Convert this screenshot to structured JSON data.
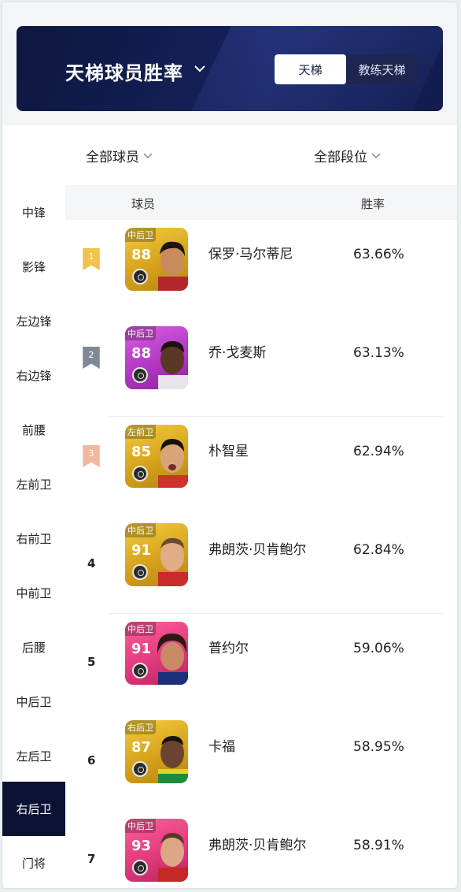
{
  "header": {
    "title": "天梯球员胜率",
    "tabs": [
      {
        "label": "天梯",
        "active": true
      },
      {
        "label": "教练天梯",
        "active": false
      }
    ]
  },
  "filters": {
    "players": "全部球员",
    "divisions": "全部段位"
  },
  "columns": {
    "player": "球员",
    "win_rate": "胜率"
  },
  "sidebar": {
    "items": [
      {
        "label": "中锋"
      },
      {
        "label": "影锋"
      },
      {
        "label": "左边锋"
      },
      {
        "label": "右边锋"
      },
      {
        "label": "前腰"
      },
      {
        "label": "左前卫"
      },
      {
        "label": "右前卫"
      },
      {
        "label": "中前卫"
      },
      {
        "label": "后腰"
      },
      {
        "label": "中后卫"
      },
      {
        "label": "左后卫"
      },
      {
        "label": "右后卫",
        "active": true
      },
      {
        "label": "门将"
      }
    ]
  },
  "rows": [
    {
      "rank": "1",
      "position": "中后卫",
      "rating": "88",
      "card": "gold",
      "name": "保罗·马尔蒂尼",
      "rate": "63.66%"
    },
    {
      "rank": "2",
      "position": "中后卫",
      "rating": "88",
      "card": "purple",
      "name": "乔·戈麦斯",
      "rate": "63.13%"
    },
    {
      "rank": "3",
      "position": "左前卫",
      "rating": "85",
      "card": "gold",
      "name": "朴智星",
      "rate": "62.94%"
    },
    {
      "rank": "4",
      "position": "中后卫",
      "rating": "91",
      "card": "gold",
      "name": "弗朗茨·贝肯鲍尔",
      "rate": "62.84%"
    },
    {
      "rank": "5",
      "position": "中后卫",
      "rating": "91",
      "card": "pink",
      "name": "普约尔",
      "rate": "59.06%"
    },
    {
      "rank": "6",
      "position": "右后卫",
      "rating": "87",
      "card": "gold",
      "name": "卡福",
      "rate": "58.95%"
    },
    {
      "rank": "7",
      "position": "中后卫",
      "rating": "93",
      "card": "pink",
      "name": "弗朗茨·贝肯鲍尔",
      "rate": "58.91%"
    }
  ],
  "colors": {
    "banner": "#141f55",
    "active_sidebar": "#0b1233",
    "rank1": "#f2c14e",
    "rank2": "#7f8896",
    "rank3": "#f0b8a0"
  }
}
